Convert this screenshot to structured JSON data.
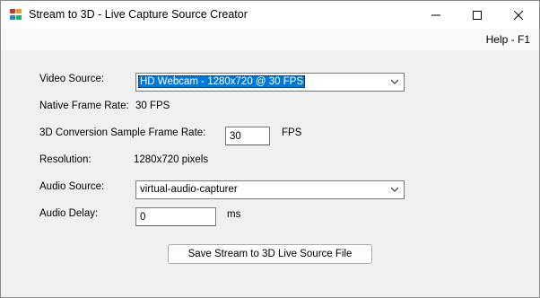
{
  "window": {
    "title": "Stream to 3D - Live Capture Source Creator",
    "minimize_icon": "minimize-icon",
    "maximize_icon": "maximize-icon",
    "close_icon": "close-icon"
  },
  "menu": {
    "help": "Help - F1"
  },
  "form": {
    "video_source_label": "Video Source:",
    "video_source_value": "HD Webcam - 1280x720 @ 30 FPS",
    "native_frame_rate_label": "Native Frame Rate:",
    "native_frame_rate_value": "30 FPS",
    "sample_rate_label": "3D Conversion Sample Frame Rate:",
    "sample_rate_value": "30",
    "sample_rate_unit": "FPS",
    "resolution_label": "Resolution:",
    "resolution_value": "1280x720 pixels",
    "audio_source_label": "Audio Source:",
    "audio_source_value": "virtual-audio-capturer",
    "audio_delay_label": "Audio Delay:",
    "audio_delay_value": "0",
    "audio_delay_unit": "ms",
    "save_button": "Save Stream to 3D Live Source File"
  },
  "colors": {
    "selection": "#0078d7",
    "window_bg": "#f0f0f0"
  }
}
